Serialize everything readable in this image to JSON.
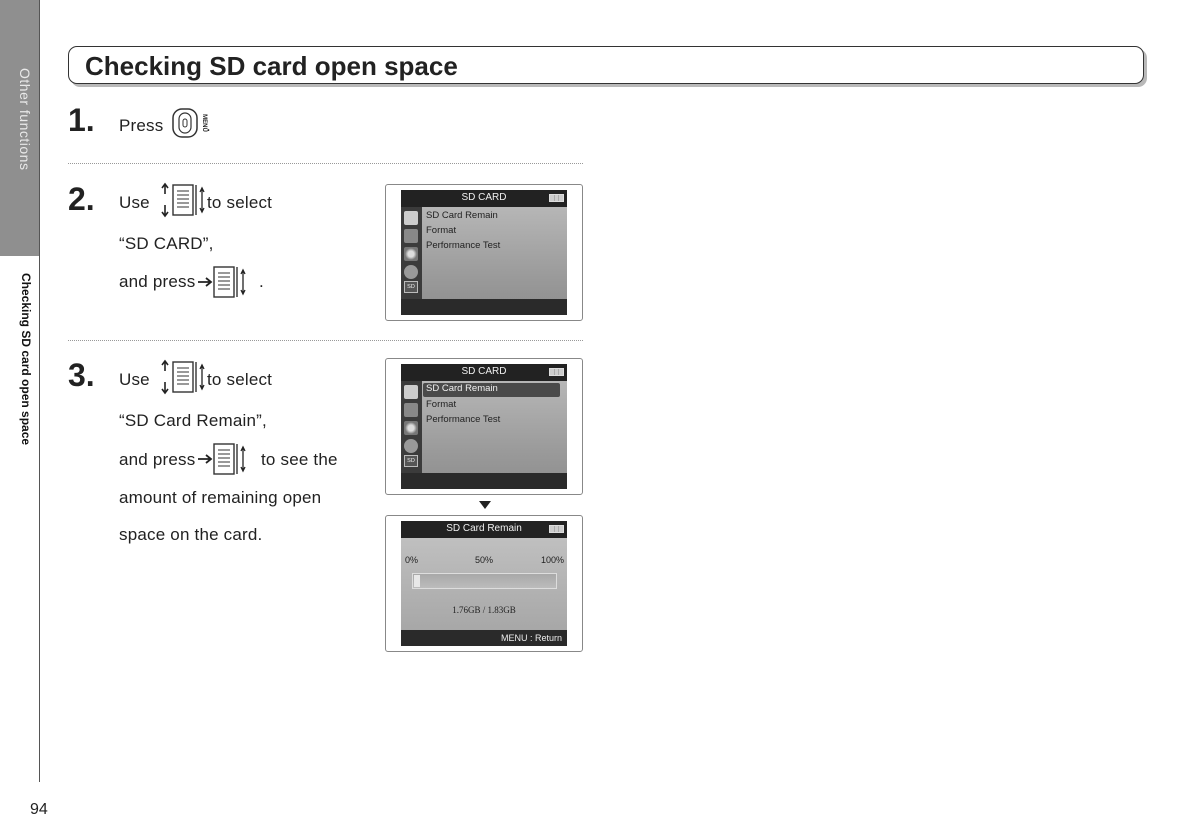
{
  "sidebar": {
    "section": "Other functions",
    "current": "Checking SD card open space",
    "page_number": "94"
  },
  "title": "Checking SD card open space",
  "steps": [
    {
      "number": "1.",
      "lines": [
        "Press",
        "."
      ]
    },
    {
      "number": "2.",
      "lines": [
        "Use",
        "to select",
        "“SD CARD”,",
        "and press",
        "."
      ]
    },
    {
      "number": "3.",
      "lines": [
        "Use",
        "to select",
        "“SD Card Remain”,",
        "and press",
        "to see the",
        "amount of remaining open",
        "space on the card."
      ]
    }
  ],
  "icons": {
    "menu_button": "menu-button-icon",
    "menu_label": "MENU",
    "scroll_wheel": "scroll-wheel-icon",
    "press_wheel": "press-wheel-icon"
  },
  "screens": {
    "sd_card_menu": {
      "title": "SD CARD",
      "items": [
        "SD Card Remain",
        "Format",
        "Performance Test"
      ],
      "sd_icon_label": "SD"
    },
    "sd_card_menu_selected": {
      "title": "SD CARD",
      "items": [
        "SD Card Remain",
        "Format",
        "Performance Test"
      ],
      "selected_index": 0,
      "sd_icon_label": "SD"
    },
    "sd_card_remain": {
      "title": "SD Card Remain",
      "scale": [
        "0%",
        "50%",
        "100%"
      ],
      "used_fraction": 0.04,
      "value": "1.76GB / 1.83GB",
      "footer": "MENU : Return"
    }
  }
}
